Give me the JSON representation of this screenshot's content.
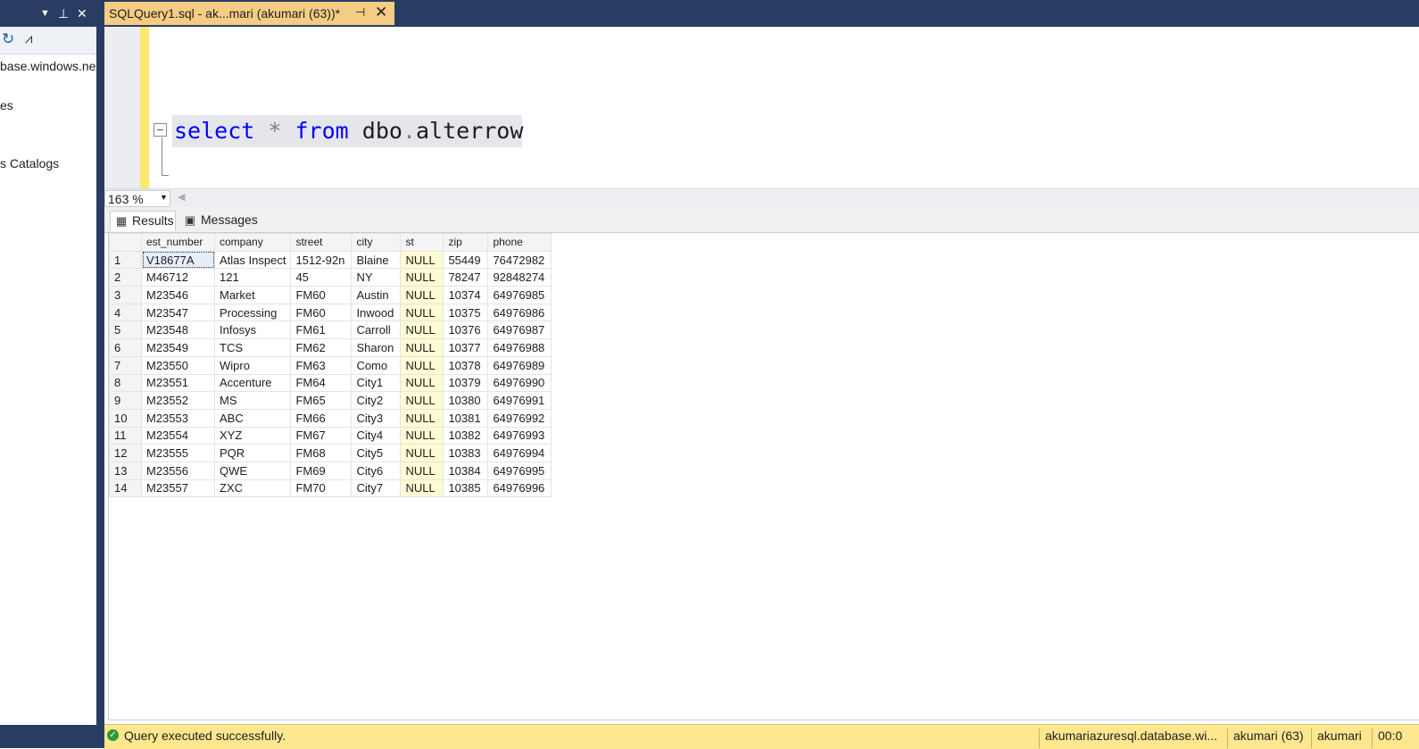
{
  "object_explorer": {
    "title_icons": [
      "chevron-down-icon",
      "pin-icon",
      "close-icon"
    ],
    "toolbar_icons": [
      "refresh-icon",
      "activity-monitor-icon"
    ],
    "tree_items": [
      "base.windows.net",
      "es",
      "s Catalogs"
    ]
  },
  "document_tab": {
    "title": "SQLQuery1.sql - ak...mari (akumari (63))*",
    "pin_glyph": "⊣",
    "close_glyph": "✕"
  },
  "editor": {
    "keyword_select": "select",
    "star": "*",
    "keyword_from": "from",
    "schema": "dbo",
    "dot": ".",
    "table": "alterrow"
  },
  "zoom": {
    "value": "163 %"
  },
  "results_tabs": [
    {
      "label": "Results",
      "icon": "grid-icon",
      "active": true
    },
    {
      "label": "Messages",
      "icon": "messages-icon",
      "active": false
    }
  ],
  "grid": {
    "columns": [
      "",
      "est_number",
      "company",
      "street",
      "city",
      "st",
      "zip",
      "phone"
    ],
    "rows": [
      [
        "1",
        "V18677A",
        "Atlas Inspect",
        "1512-92n",
        "Blaine",
        "NULL",
        "55449",
        "76472982"
      ],
      [
        "2",
        "M46712",
        "121",
        "45",
        "NY",
        "NULL",
        "78247",
        "92848274"
      ],
      [
        "3",
        "M23546",
        "Market",
        "FM60",
        "Austin",
        "NULL",
        "10374",
        "64976985"
      ],
      [
        "4",
        "M23547",
        "Processing",
        "FM60",
        "Inwood",
        "NULL",
        "10375",
        "64976986"
      ],
      [
        "5",
        "M23548",
        "Infosys",
        "FM61",
        "Carroll",
        "NULL",
        "10376",
        "64976987"
      ],
      [
        "6",
        "M23549",
        "TCS",
        "FM62",
        "Sharon",
        "NULL",
        "10377",
        "64976988"
      ],
      [
        "7",
        "M23550",
        "Wipro",
        "FM63",
        "Como",
        "NULL",
        "10378",
        "64976989"
      ],
      [
        "8",
        "M23551",
        "Accenture",
        "FM64",
        "City1",
        "NULL",
        "10379",
        "64976990"
      ],
      [
        "9",
        "M23552",
        "MS",
        "FM65",
        "City2",
        "NULL",
        "10380",
        "64976991"
      ],
      [
        "10",
        "M23553",
        "ABC",
        "FM66",
        "City3",
        "NULL",
        "10381",
        "64976992"
      ],
      [
        "11",
        "M23554",
        "XYZ",
        "FM67",
        "City4",
        "NULL",
        "10382",
        "64976993"
      ],
      [
        "12",
        "M23555",
        "PQR",
        "FM68",
        "City5",
        "NULL",
        "10383",
        "64976994"
      ],
      [
        "13",
        "M23556",
        "QWE",
        "FM69",
        "City6",
        "NULL",
        "10384",
        "64976995"
      ],
      [
        "14",
        "M23557",
        "ZXC",
        "FM70",
        "City7",
        "NULL",
        "10385",
        "64976996"
      ]
    ]
  },
  "status_bar": {
    "message": "Query executed successfully.",
    "server": "akumariazuresql.database.wi...",
    "user": "akumari (63)",
    "database": "akumari",
    "time": "00:0"
  },
  "colors": {
    "chrome_dark": "#283d61",
    "active_tab": "#f5cc84",
    "status_bar": "#ffe790",
    "keyword": "#0000ff",
    "null_cell": "#fffbd4"
  }
}
